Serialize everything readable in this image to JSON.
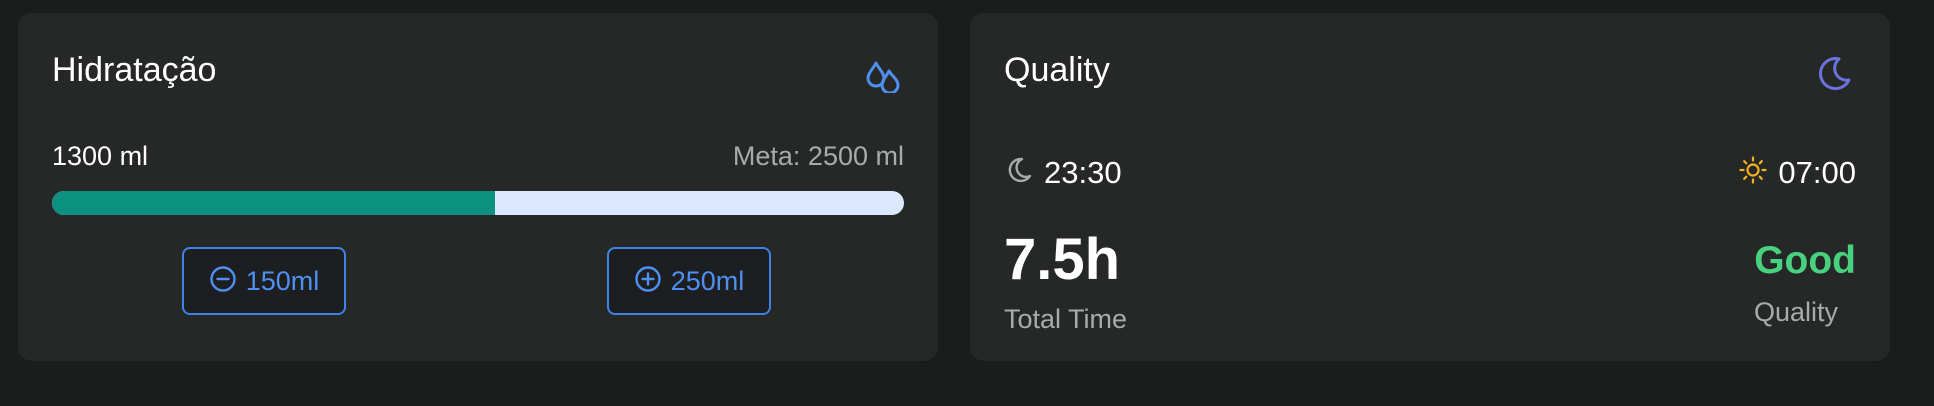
{
  "hydration": {
    "title": "Hidratação",
    "icon": "water-drops-icon",
    "current": "1300 ml",
    "goal": "Meta: 2500 ml",
    "progress_fraction": 0.52,
    "colors": {
      "fill": "#0c907f",
      "track": "#dce8ff",
      "accent": "#4f8ff0"
    },
    "buttons": [
      {
        "label": "150ml",
        "icon": "minus-circle-icon"
      },
      {
        "label": "250ml",
        "icon": "plus-circle-icon"
      }
    ]
  },
  "sleep": {
    "title": "Quality",
    "icon": "moon-icon",
    "bedtime": {
      "icon": "moon-icon",
      "time": "23:30"
    },
    "waketime": {
      "icon": "sun-icon",
      "time": "07:00"
    },
    "total_value": "7.5h",
    "total_label": "Total Time",
    "quality_value": "Good",
    "quality_label": "Quality",
    "colors": {
      "moon": "#6a74e0",
      "sun": "#f2b21d",
      "good": "#48d17e"
    }
  }
}
